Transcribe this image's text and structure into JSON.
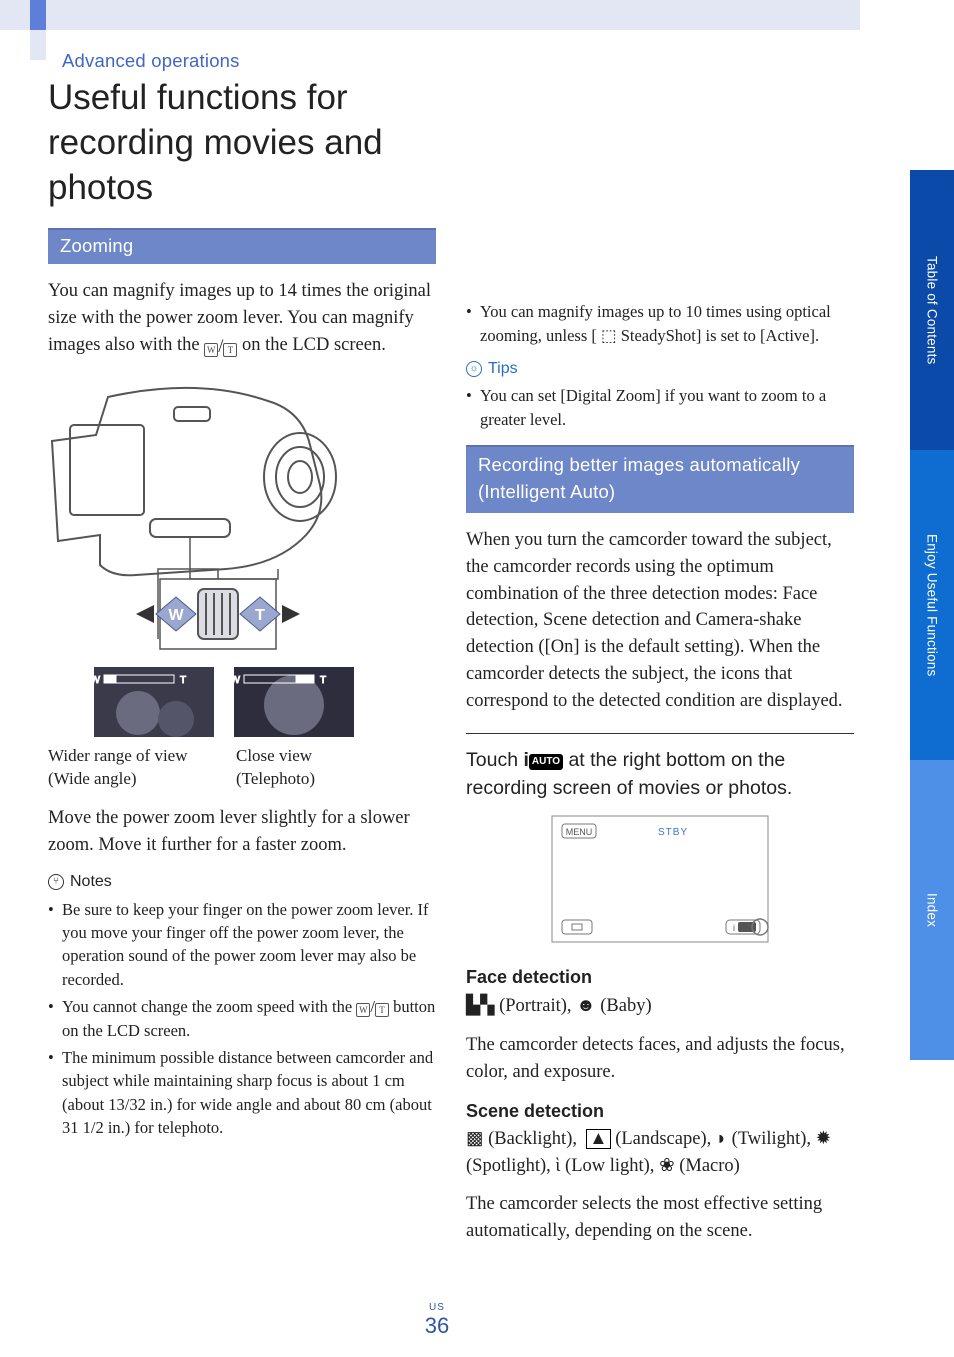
{
  "header": {
    "section_label": "Advanced operations",
    "title": "Useful functions for recording movies and photos"
  },
  "tabs": [
    {
      "label": "Table of Contents"
    },
    {
      "label": "Enjoy Useful Functions"
    },
    {
      "label": "Index"
    }
  ],
  "page": {
    "region": "US",
    "number": "36"
  },
  "left": {
    "zooming": {
      "heading": "Zooming",
      "p1a": "You can magnify images up to 14 times the original size with the power zoom lever. You can magnify images also with the ",
      "p1b": " on the LCD screen.",
      "fig": {
        "wide_a": "Wider range of view",
        "wide_b": "(Wide angle)",
        "tele_a": "Close view",
        "tele_b": "(Telephoto)",
        "w_label": "W",
        "t_label": "T"
      },
      "p2": "Move the power zoom lever slightly for a slower zoom. Move it further for a faster zoom.",
      "notes_h": "Notes",
      "notes": [
        "Be sure to keep your finger on the power zoom lever. If you move your finger off the power zoom lever, the operation sound of the power zoom lever may also be recorded.",
        "You cannot change the zoom speed with the W/T button on the LCD screen.",
        "The minimum possible distance between camcorder and subject while maintaining sharp focus is about 1 cm (about 13/32 in.) for wide angle and about 80 cm (about 31 1/2 in.) for telephoto."
      ]
    }
  },
  "right": {
    "top_bullets": [
      "You can magnify images up to 10 times using optical zooming, unless [ ⬚ SteadyShot] is set to [Active]."
    ],
    "tips_h": "Tips",
    "tips": [
      "You can set [Digital Zoom] if you want to zoom to a greater level."
    ],
    "iauto": {
      "heading": "Recording better images automatically (Intelligent Auto)",
      "p1": "When you turn the camcorder toward the subject, the camcorder records using the optimum combination of the three detection modes: Face detection, Scene detection and Camera-shake detection ([On] is the default setting). When the camcorder detects the subject, the icons that correspond to the detected condition are displayed.",
      "touch_a": "Touch ",
      "touch_b": " at the right bottom on the recording screen of movies or photos.",
      "lcd": {
        "menu": "MENU",
        "stby": "STBY"
      },
      "face_h": "Face detection",
      "face_line": " (Portrait),  (Baby)",
      "face_p": "The camcorder detects faces, and adjusts the focus, color, and exposure.",
      "scene_h": "Scene detection",
      "scene_line_a": " (Backlight),  (Landscape),  (Twilight),  (Spotlight),  (Low light),  (Macro)",
      "scene_p": "The camcorder selects the most effective setting automatically, depending on the scene."
    }
  }
}
